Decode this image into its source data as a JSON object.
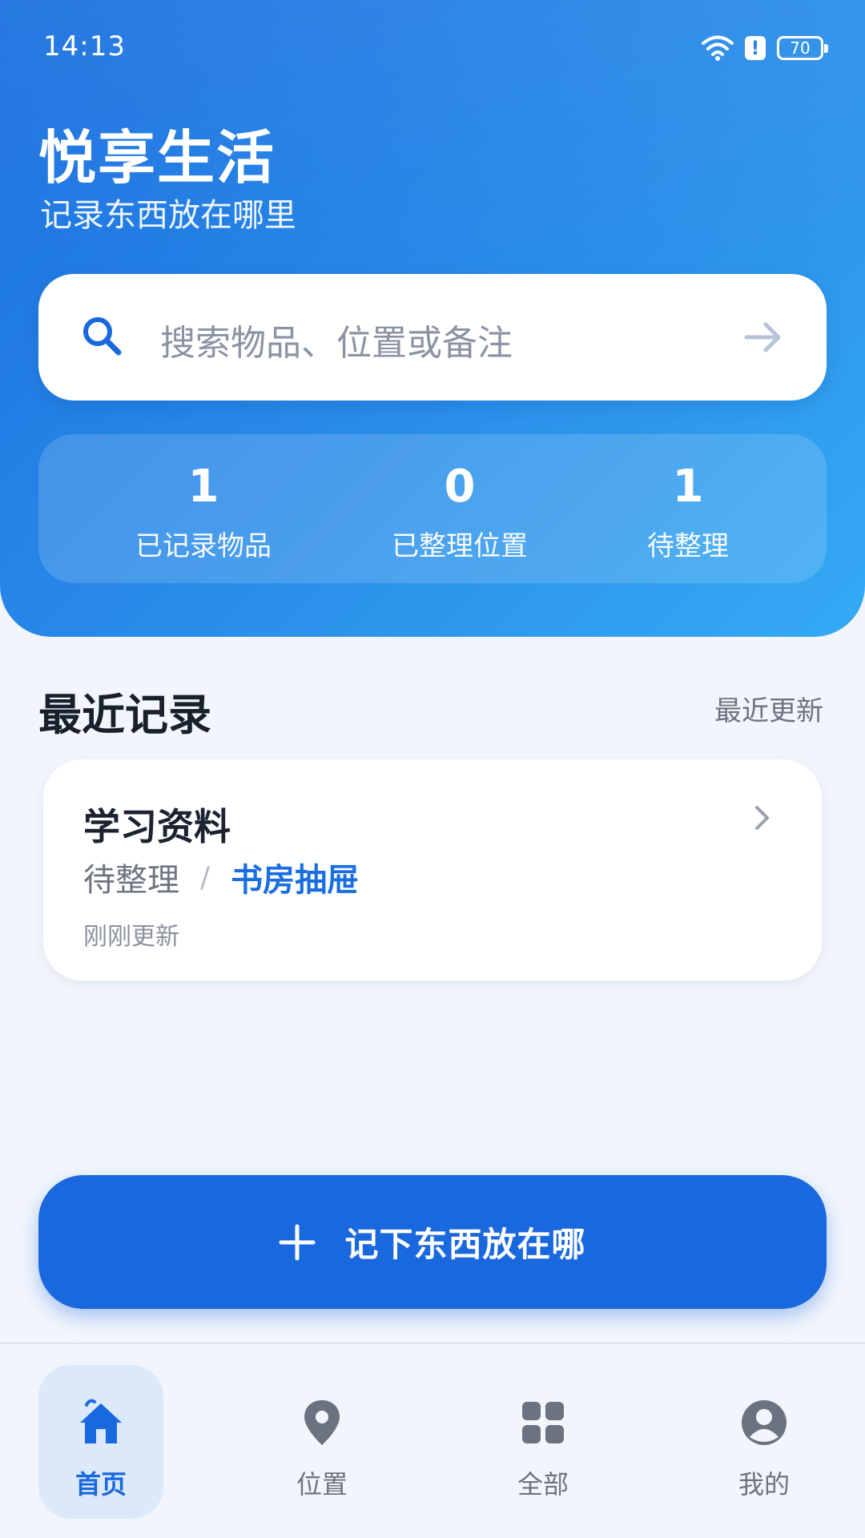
{
  "status_bar": {
    "time": "14:13",
    "battery": "70",
    "icons": [
      "wifi-icon",
      "alert-icon",
      "battery-icon"
    ]
  },
  "header": {
    "title": "悦享生活",
    "subtitle": "记录东西放在哪里"
  },
  "search": {
    "placeholder": "搜索物品、位置或备注",
    "icon": "search-icon",
    "action_icon": "arrow-right-icon"
  },
  "stats": [
    {
      "value": "1",
      "label": "已记录物品"
    },
    {
      "value": "0",
      "label": "已整理位置"
    },
    {
      "value": "1",
      "label": "待整理"
    }
  ],
  "recent": {
    "title": "最近记录",
    "sort_label": "最近更新",
    "items": [
      {
        "name": "学习资料",
        "status": "待整理",
        "separator": "/",
        "location": "书房抽屉",
        "updated": "刚刚更新"
      }
    ]
  },
  "add_button": {
    "label": "记下东西放在哪",
    "icon": "plus-icon"
  },
  "bottom_nav": {
    "items": [
      {
        "label": "首页",
        "icon": "home-icon",
        "active": true
      },
      {
        "label": "位置",
        "icon": "location-pin-icon",
        "active": false
      },
      {
        "label": "全部",
        "icon": "grid-icon",
        "active": false
      },
      {
        "label": "我的",
        "icon": "profile-icon",
        "active": false
      }
    ]
  },
  "colors": {
    "primary": "#1a68dd",
    "header_gradient_start": "#1b6fe0",
    "header_gradient_end": "#35aaf3",
    "background": "#f2f6fc",
    "location_text": "#1a6ee0"
  }
}
